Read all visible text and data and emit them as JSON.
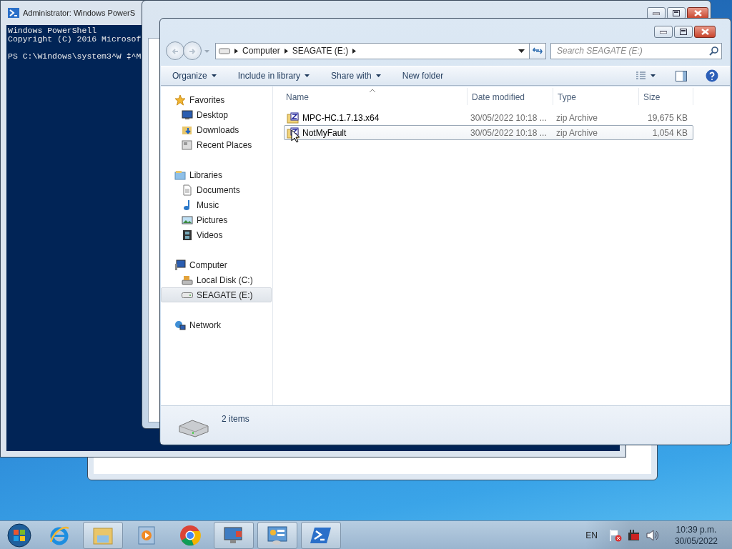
{
  "powershell": {
    "title": "Administrator: Windows PowerS",
    "lines": [
      "Windows PowerShell",
      "Copyright (C) 2016 Microsof"
    ],
    "prompt": "PS C:\\Windows\\system3^W ‡^M"
  },
  "explorer": {
    "address": [
      "Computer",
      "SEAGATE (E:)"
    ],
    "search": {
      "placeholder": "Search SEAGATE (E:)"
    },
    "toolbar": [
      {
        "label": "Organize",
        "dropdown": true
      },
      {
        "label": "Include in library",
        "dropdown": true
      },
      {
        "label": "Share with",
        "dropdown": true
      },
      {
        "label": "New folder",
        "dropdown": false
      }
    ],
    "sidebar": [
      {
        "label": "Favorites",
        "selected": false,
        "children": [
          {
            "label": "Desktop",
            "selected": false
          },
          {
            "label": "Downloads",
            "selected": false
          },
          {
            "label": "Recent Places",
            "selected": false
          }
        ]
      },
      {
        "label": "Libraries",
        "selected": false,
        "children": [
          {
            "label": "Documents",
            "selected": false
          },
          {
            "label": "Music",
            "selected": false
          },
          {
            "label": "Pictures",
            "selected": false
          },
          {
            "label": "Videos",
            "selected": false
          }
        ]
      },
      {
        "label": "Computer",
        "selected": false,
        "children": [
          {
            "label": "Local Disk (C:)",
            "selected": false
          },
          {
            "label": "SEAGATE (E:)",
            "selected": true
          }
        ]
      },
      {
        "label": "Network",
        "selected": false
      }
    ],
    "columns": [
      "Name",
      "Date modified",
      "Type",
      "Size"
    ],
    "files": [
      {
        "name": "MPC-HC.1.7.13.x64",
        "date": "30/05/2022 10:18 ...",
        "type": "zip Archive",
        "size": "19,675 KB",
        "selected": false
      },
      {
        "name": "NotMyFault",
        "date": "30/05/2022 10:18 ...",
        "type": "zip Archive",
        "size": "1,054 KB",
        "selected": true
      }
    ],
    "status": "2 items"
  },
  "taskbar": {
    "apps": [
      {
        "kind": "ie",
        "open": false
      },
      {
        "kind": "explorer",
        "open": true
      },
      {
        "kind": "media",
        "open": false
      },
      {
        "kind": "chrome",
        "open": false
      },
      {
        "kind": "remote",
        "open": true
      },
      {
        "kind": "control",
        "open": true
      },
      {
        "kind": "powershell",
        "open": true
      }
    ],
    "language": "EN",
    "time": "10:39 p.m.",
    "date": "30/05/2022"
  }
}
